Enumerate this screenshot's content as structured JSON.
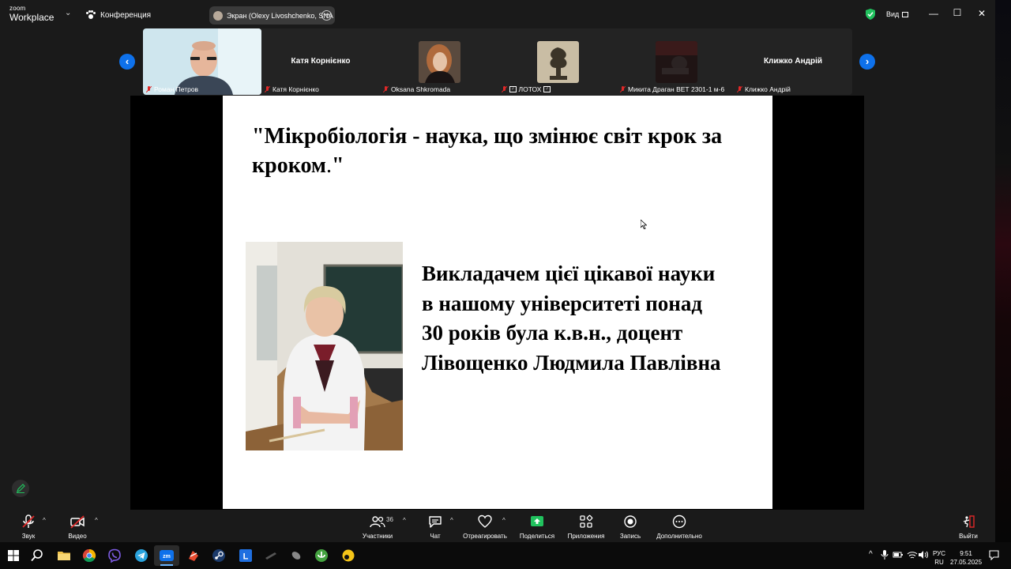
{
  "app": {
    "logo_top": "zoom",
    "logo_bottom": "Workplace",
    "meeting_label": "Конференция",
    "screen_share_label": "Экран (Olexy Livoshchenko, SNA",
    "view_label": "Вид"
  },
  "participants": [
    {
      "name": "Роман Петров",
      "display_name": "",
      "muted": true
    },
    {
      "name": "Катя Корнієнко",
      "display_name": "Катя Корнієнко",
      "muted": true
    },
    {
      "name": "Oksana Shkromada",
      "display_name": "",
      "muted": true
    },
    {
      "name": "ЛОТОХ",
      "display_name": "",
      "muted": true
    },
    {
      "name": "Микита Драган ВЕТ 2301-1 м-6",
      "display_name": "",
      "muted": true
    },
    {
      "name": "Клижко Андрій",
      "display_name": "Клижко Андрій",
      "muted": true
    }
  ],
  "slide": {
    "title_main": "\"Мікробіологія - наука, що змінює світ крок за кроком",
    "title_dot": ".",
    "title_end": "\"",
    "body_lines": [
      "Викладачем цієї цікавої  науки",
      "в нашому університеті понад",
      "30 років була к.в.н., доцент",
      "Лівощенко Людмила Павлівна"
    ]
  },
  "toolbar": {
    "audio": "Звук",
    "video": "Видео",
    "participants": "Участники",
    "participants_count": "36",
    "chat": "Чат",
    "react": "Отреагировать",
    "share": "Поделиться",
    "apps": "Приложения",
    "record": "Запись",
    "more": "Дополнительно",
    "leave": "Выйти"
  },
  "taskbar": {
    "lang_top": "РУС",
    "lang_bottom": "RU",
    "time": "9:51",
    "date": "27.05.2025"
  },
  "colors": {
    "accent_blue": "#0e71eb",
    "mute_red": "#e02828",
    "share_green": "#21c25e"
  }
}
